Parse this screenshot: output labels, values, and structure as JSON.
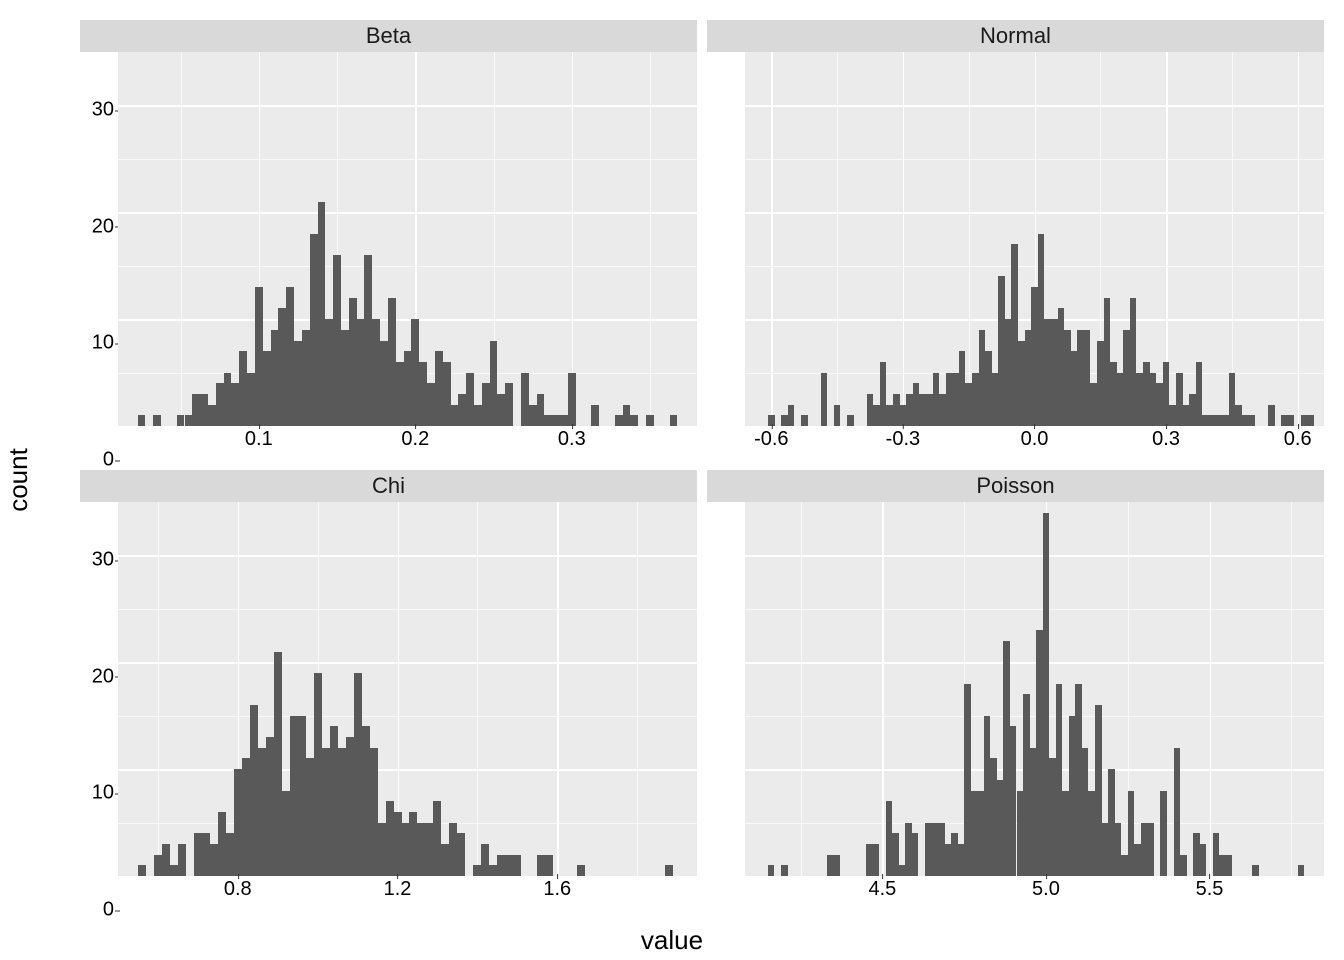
{
  "xlabel": "value",
  "ylabel": "count",
  "chart_data": [
    {
      "name": "Beta",
      "type": "bar",
      "ylim": [
        0,
        35
      ],
      "yticks": [
        0,
        10,
        20,
        30
      ],
      "xlim": [
        0.01,
        0.38
      ],
      "xticks": [
        0.1,
        0.2,
        0.3
      ],
      "x": [
        0.025,
        0.03,
        0.035,
        0.04,
        0.045,
        0.05,
        0.055,
        0.06,
        0.065,
        0.07,
        0.075,
        0.08,
        0.085,
        0.09,
        0.095,
        0.1,
        0.105,
        0.11,
        0.115,
        0.12,
        0.125,
        0.13,
        0.135,
        0.14,
        0.145,
        0.15,
        0.155,
        0.16,
        0.165,
        0.17,
        0.175,
        0.18,
        0.185,
        0.19,
        0.195,
        0.2,
        0.205,
        0.21,
        0.215,
        0.22,
        0.225,
        0.23,
        0.235,
        0.24,
        0.245,
        0.25,
        0.255,
        0.26,
        0.265,
        0.27,
        0.275,
        0.28,
        0.285,
        0.29,
        0.295,
        0.3,
        0.305,
        0.31,
        0.315,
        0.32,
        0.325,
        0.33,
        0.335,
        0.34,
        0.345,
        0.35,
        0.355,
        0.36,
        0.365
      ],
      "values": [
        1,
        0,
        1,
        0,
        0,
        1,
        1,
        3,
        3,
        2,
        4,
        5,
        4,
        7,
        5,
        13,
        7,
        9,
        11,
        13,
        8,
        9,
        18,
        21,
        10,
        16,
        9,
        12,
        10,
        16,
        10,
        8,
        12,
        6,
        7,
        10,
        6,
        4,
        7,
        6,
        2,
        3,
        5,
        2,
        4,
        8,
        3,
        4,
        0,
        5,
        2,
        3,
        1,
        1,
        1,
        5,
        0,
        0,
        2,
        0,
        0,
        1,
        2,
        1,
        0,
        1,
        0,
        0,
        1
      ]
    },
    {
      "name": "Normal",
      "type": "bar",
      "ylim": [
        0,
        35
      ],
      "yticks": [
        0,
        10,
        20,
        30
      ],
      "xlim": [
        -0.66,
        0.66
      ],
      "xticks": [
        -0.6,
        -0.3,
        0.0,
        0.3,
        0.6
      ],
      "x": [
        -0.6,
        -0.585,
        -0.57,
        -0.555,
        -0.54,
        -0.525,
        -0.51,
        -0.495,
        -0.48,
        -0.465,
        -0.45,
        -0.435,
        -0.42,
        -0.405,
        -0.39,
        -0.375,
        -0.36,
        -0.345,
        -0.33,
        -0.315,
        -0.3,
        -0.285,
        -0.27,
        -0.255,
        -0.24,
        -0.225,
        -0.21,
        -0.195,
        -0.18,
        -0.165,
        -0.15,
        -0.135,
        -0.12,
        -0.105,
        -0.09,
        -0.075,
        -0.06,
        -0.045,
        -0.03,
        -0.015,
        0.0,
        0.015,
        0.03,
        0.045,
        0.06,
        0.075,
        0.09,
        0.105,
        0.12,
        0.135,
        0.15,
        0.165,
        0.18,
        0.195,
        0.21,
        0.225,
        0.24,
        0.255,
        0.27,
        0.285,
        0.3,
        0.315,
        0.33,
        0.345,
        0.36,
        0.375,
        0.39,
        0.405,
        0.42,
        0.435,
        0.45,
        0.465,
        0.48,
        0.495,
        0.51,
        0.525,
        0.54,
        0.555,
        0.57,
        0.585,
        0.6,
        0.615,
        0.63
      ],
      "values": [
        1,
        0,
        1,
        2,
        0,
        1,
        0,
        0,
        5,
        0,
        2,
        0,
        1,
        0,
        0,
        3,
        2,
        6,
        2,
        3,
        2,
        3,
        4,
        3,
        3,
        5,
        3,
        5,
        5,
        7,
        4,
        5,
        9,
        7,
        5,
        14,
        10,
        17,
        8,
        9,
        13,
        18,
        10,
        10,
        11,
        9,
        7,
        9,
        9,
        4,
        8,
        12,
        6,
        5,
        9,
        12,
        5,
        6,
        5,
        4,
        6,
        2,
        5,
        2,
        3,
        6,
        1,
        1,
        1,
        1,
        5,
        2,
        1,
        1,
        0,
        0,
        2,
        0,
        1,
        1,
        0,
        1,
        1
      ]
    },
    {
      "name": "Chi",
      "type": "bar",
      "ylim": [
        0,
        35
      ],
      "yticks": [
        0,
        10,
        20,
        30
      ],
      "xlim": [
        0.5,
        1.95
      ],
      "xticks": [
        0.8,
        1.2,
        1.6
      ],
      "x": [
        0.56,
        0.58,
        0.6,
        0.62,
        0.64,
        0.66,
        0.68,
        0.7,
        0.72,
        0.74,
        0.76,
        0.78,
        0.8,
        0.82,
        0.84,
        0.86,
        0.88,
        0.9,
        0.92,
        0.94,
        0.96,
        0.98,
        1.0,
        1.02,
        1.04,
        1.06,
        1.08,
        1.1,
        1.12,
        1.14,
        1.16,
        1.18,
        1.2,
        1.22,
        1.24,
        1.26,
        1.28,
        1.3,
        1.32,
        1.34,
        1.36,
        1.38,
        1.4,
        1.42,
        1.44,
        1.46,
        1.48,
        1.5,
        1.52,
        1.54,
        1.56,
        1.58,
        1.6,
        1.62,
        1.64,
        1.66,
        1.86,
        1.88
      ],
      "values": [
        1,
        0,
        2,
        3,
        1,
        3,
        0,
        4,
        4,
        3,
        6,
        4,
        10,
        11,
        16,
        12,
        13,
        21,
        8,
        15,
        15,
        11,
        19,
        12,
        14,
        12,
        13,
        19,
        14,
        12,
        5,
        7,
        6,
        5,
        6,
        5,
        5,
        7,
        3,
        5,
        4,
        0,
        1,
        3,
        1,
        2,
        2,
        2,
        0,
        0,
        2,
        2,
        0,
        0,
        0,
        1,
        0,
        1
      ]
    },
    {
      "name": "Poisson",
      "type": "bar",
      "ylim": [
        0,
        35
      ],
      "yticks": [
        0,
        10,
        20,
        30
      ],
      "xlim": [
        4.08,
        5.85
      ],
      "xticks": [
        4.5,
        5.0,
        5.5
      ],
      "x": [
        4.16,
        4.18,
        4.2,
        4.34,
        4.36,
        4.38,
        4.46,
        4.48,
        4.5,
        4.52,
        4.54,
        4.56,
        4.58,
        4.6,
        4.62,
        4.64,
        4.66,
        4.68,
        4.7,
        4.72,
        4.74,
        4.76,
        4.78,
        4.8,
        4.82,
        4.84,
        4.86,
        4.88,
        4.9,
        4.92,
        4.94,
        4.96,
        4.98,
        5.0,
        5.02,
        5.04,
        5.06,
        5.08,
        5.1,
        5.12,
        5.14,
        5.16,
        5.18,
        5.2,
        5.22,
        5.24,
        5.26,
        5.28,
        5.3,
        5.32,
        5.34,
        5.36,
        5.38,
        5.4,
        5.42,
        5.44,
        5.46,
        5.48,
        5.5,
        5.52,
        5.54,
        5.56,
        5.64,
        5.76,
        5.78
      ],
      "values": [
        1,
        0,
        1,
        2,
        2,
        0,
        3,
        3,
        0,
        7,
        4,
        1,
        5,
        4,
        0,
        5,
        5,
        5,
        3,
        4,
        3,
        18,
        8,
        8,
        15,
        11,
        9,
        22,
        14,
        8,
        17,
        12,
        23,
        34,
        11,
        18,
        8,
        15,
        18,
        12,
        8,
        16,
        5,
        10,
        5,
        2,
        8,
        3,
        5,
        5,
        0,
        8,
        0,
        12,
        2,
        0,
        4,
        3,
        0,
        4,
        2,
        2,
        1,
        0,
        1
      ]
    }
  ]
}
